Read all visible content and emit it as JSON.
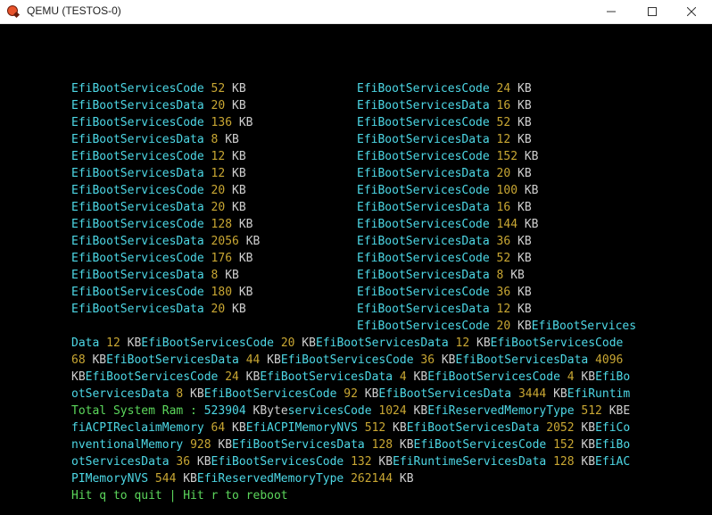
{
  "window": {
    "title": "QEMU (TESTOS-0)",
    "icon": "qemu-icon",
    "controls": [
      "minimize-icon",
      "maximize-icon",
      "close-icon"
    ]
  },
  "colors": {
    "type": "#4dd8e6",
    "size": "#c9a733",
    "unit": "#cfcfcf",
    "total_label": "#5cd85c",
    "footer": "#5cd85c",
    "background": "#000000"
  },
  "left_column": [
    {
      "type": "EfiBootServicesCode",
      "size": "52",
      "unit": "KB"
    },
    {
      "type": "EfiBootServicesData",
      "size": "20",
      "unit": "KB"
    },
    {
      "type": "EfiBootServicesCode",
      "size": "136",
      "unit": "KB"
    },
    {
      "type": "EfiBootServicesData",
      "size": "8",
      "unit": "KB"
    },
    {
      "type": "EfiBootServicesCode",
      "size": "12",
      "unit": "KB"
    },
    {
      "type": "EfiBootServicesData",
      "size": "12",
      "unit": "KB"
    },
    {
      "type": "EfiBootServicesCode",
      "size": "20",
      "unit": "KB"
    },
    {
      "type": "EfiBootServicesData",
      "size": "20",
      "unit": "KB"
    },
    {
      "type": "EfiBootServicesCode",
      "size": "128",
      "unit": "KB"
    },
    {
      "type": "EfiBootServicesData",
      "size": "2056",
      "unit": "KB"
    },
    {
      "type": "EfiBootServicesCode",
      "size": "176",
      "unit": "KB"
    },
    {
      "type": "EfiBootServicesData",
      "size": "8",
      "unit": "KB"
    },
    {
      "type": "EfiBootServicesCode",
      "size": "180",
      "unit": "KB"
    },
    {
      "type": "EfiBootServicesData",
      "size": "20",
      "unit": "KB"
    }
  ],
  "right_column": [
    {
      "type": "EfiBootServicesCode",
      "size": "24",
      "unit": "KB"
    },
    {
      "type": "EfiBootServicesData",
      "size": "16",
      "unit": "KB"
    },
    {
      "type": "EfiBootServicesCode",
      "size": "52",
      "unit": "KB"
    },
    {
      "type": "EfiBootServicesData",
      "size": "12",
      "unit": "KB"
    },
    {
      "type": "EfiBootServicesCode",
      "size": "152",
      "unit": "KB"
    },
    {
      "type": "EfiBootServicesData",
      "size": "20",
      "unit": "KB"
    },
    {
      "type": "EfiBootServicesCode",
      "size": "100",
      "unit": "KB"
    },
    {
      "type": "EfiBootServicesData",
      "size": "16",
      "unit": "KB"
    },
    {
      "type": "EfiBootServicesCode",
      "size": "144",
      "unit": "KB"
    },
    {
      "type": "EfiBootServicesData",
      "size": "36",
      "unit": "KB"
    },
    {
      "type": "EfiBootServicesCode",
      "size": "52",
      "unit": "KB"
    },
    {
      "type": "EfiBootServicesData",
      "size": "8",
      "unit": "KB"
    },
    {
      "type": "EfiBootServicesCode",
      "size": "36",
      "unit": "KB"
    },
    {
      "type": "EfiBootServicesData",
      "size": "12",
      "unit": "KB"
    }
  ],
  "overflow_lines": [
    [
      [
        "c",
        "EfiBootServicesCode "
      ],
      [
        "y",
        "20"
      ],
      [
        "w",
        " KB"
      ],
      [
        "c",
        "EfiBootServices"
      ]
    ],
    [
      [
        "c",
        "Data "
      ],
      [
        "y",
        "12"
      ],
      [
        "w",
        " KB"
      ],
      [
        "c",
        "EfiBootServicesCode "
      ],
      [
        "y",
        "20"
      ],
      [
        "w",
        " KB"
      ],
      [
        "c",
        "EfiBootServicesData "
      ],
      [
        "y",
        "12"
      ],
      [
        "w",
        " KB"
      ],
      [
        "c",
        "EfiBootServicesCode"
      ]
    ],
    [
      [
        "y",
        "68"
      ],
      [
        "w",
        " KB"
      ],
      [
        "c",
        "EfiBootServicesData "
      ],
      [
        "y",
        "44"
      ],
      [
        "w",
        " KB"
      ],
      [
        "c",
        "EfiBootServicesCode "
      ],
      [
        "y",
        "36"
      ],
      [
        "w",
        " KB"
      ],
      [
        "c",
        "EfiBootServicesData "
      ],
      [
        "y",
        "4096"
      ]
    ],
    [
      [
        "w",
        "KB"
      ],
      [
        "c",
        "EfiBootServicesCode "
      ],
      [
        "y",
        "24"
      ],
      [
        "w",
        " KB"
      ],
      [
        "c",
        "EfiBootServicesData "
      ],
      [
        "y",
        "4"
      ],
      [
        "w",
        " KB"
      ],
      [
        "c",
        "EfiBootServicesCode "
      ],
      [
        "y",
        "4"
      ],
      [
        "w",
        " KB"
      ],
      [
        "c",
        "EfiBo"
      ]
    ],
    [
      [
        "c",
        "otServicesData "
      ],
      [
        "y",
        "8"
      ],
      [
        "w",
        " KB"
      ],
      [
        "c",
        "EfiBootServicesCode "
      ],
      [
        "y",
        "92"
      ],
      [
        "w",
        " KB"
      ],
      [
        "c",
        "EfiBootServicesData "
      ],
      [
        "y",
        "3444"
      ],
      [
        "w",
        " KB"
      ],
      [
        "c",
        "EfiRuntim"
      ]
    ],
    [
      [
        "g",
        "Total System Ram : "
      ],
      [
        "c",
        "523904 "
      ],
      [
        "w",
        "KByte"
      ],
      [
        "c",
        "servicesCode "
      ],
      [
        "y",
        "1024"
      ],
      [
        "w",
        " KB"
      ],
      [
        "c",
        "EfiReservedMemoryType "
      ],
      [
        "y",
        "512"
      ],
      [
        "w",
        " KBE"
      ]
    ],
    [
      [
        "c",
        "fiACPIReclaimMemory "
      ],
      [
        "y",
        "64"
      ],
      [
        "w",
        " KB"
      ],
      [
        "c",
        "EfiACPIMemoryNVS "
      ],
      [
        "y",
        "512"
      ],
      [
        "w",
        " KB"
      ],
      [
        "c",
        "EfiBootServicesData "
      ],
      [
        "y",
        "2052"
      ],
      [
        "w",
        " KB"
      ],
      [
        "c",
        "EfiCo"
      ]
    ],
    [
      [
        "c",
        "nventionalMemory "
      ],
      [
        "y",
        "928"
      ],
      [
        "w",
        " KB"
      ],
      [
        "c",
        "EfiBootServicesData "
      ],
      [
        "y",
        "128"
      ],
      [
        "w",
        " KB"
      ],
      [
        "c",
        "EfiBootServicesCode "
      ],
      [
        "y",
        "152"
      ],
      [
        "w",
        " KB"
      ],
      [
        "c",
        "EfiBo"
      ]
    ],
    [
      [
        "c",
        "otServicesData "
      ],
      [
        "y",
        "36"
      ],
      [
        "w",
        " KB"
      ],
      [
        "c",
        "EfiBootServicesCode "
      ],
      [
        "y",
        "132"
      ],
      [
        "w",
        " KB"
      ],
      [
        "c",
        "EfiRuntimeServicesData "
      ],
      [
        "y",
        "128"
      ],
      [
        "w",
        " KB"
      ],
      [
        "c",
        "EfiAC"
      ]
    ],
    [
      [
        "c",
        "PIMemoryNVS "
      ],
      [
        "y",
        "544"
      ],
      [
        "w",
        " KB"
      ],
      [
        "c",
        "EfiReservedMemoryType "
      ],
      [
        "y",
        "262144"
      ],
      [
        "w",
        " KB"
      ]
    ]
  ],
  "footer": "Hit q to quit | Hit r to reboot"
}
